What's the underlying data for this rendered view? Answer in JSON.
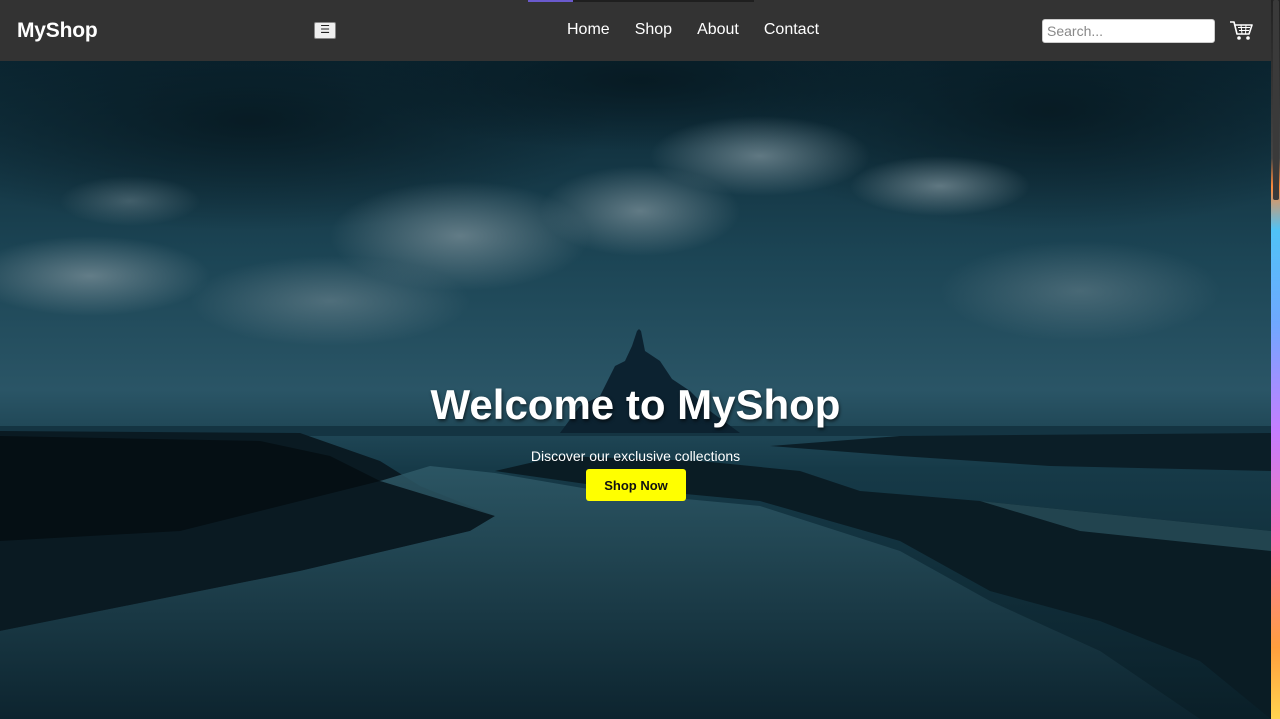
{
  "brand": {
    "name": "MyShop"
  },
  "nav": {
    "menu_toggle_icon": "☰",
    "links": [
      "Home",
      "Shop",
      "About",
      "Contact"
    ],
    "search": {
      "placeholder": "Search...",
      "value": ""
    },
    "cart_icon": "cart-icon"
  },
  "hero": {
    "title": "Welcome to MyShop",
    "subtitle": "Discover our exclusive collections",
    "cta_label": "Shop Now"
  },
  "colors": {
    "navbar": "#333333",
    "cta": "#ffff00",
    "text": "#ffffff"
  }
}
